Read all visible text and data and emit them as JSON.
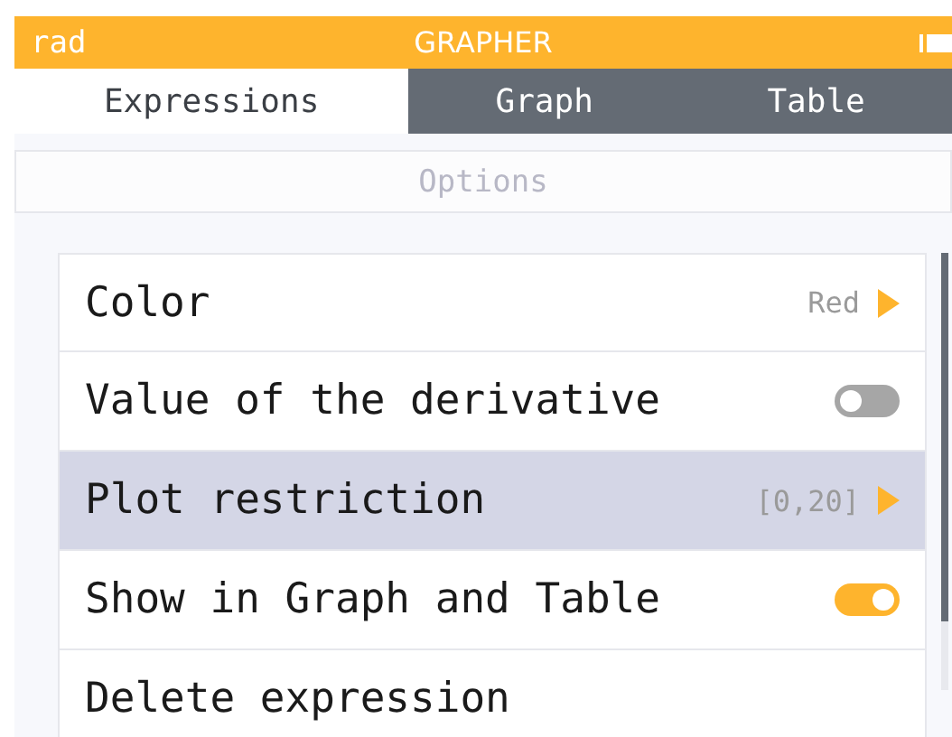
{
  "status_bar": {
    "angle_mode": "rad",
    "title": "GRAPHER"
  },
  "tabs": [
    {
      "label": "Expressions",
      "selected": true
    },
    {
      "label": "Graph",
      "selected": false
    },
    {
      "label": "Table",
      "selected": false
    }
  ],
  "header": {
    "title": "Options"
  },
  "options": [
    {
      "kind": "submenu",
      "label": "Color",
      "value": "Red",
      "selected": false
    },
    {
      "kind": "toggle",
      "label": "Value of the derivative",
      "on": false,
      "selected": false
    },
    {
      "kind": "submenu",
      "label": "Plot restriction",
      "value": "[0,20]",
      "selected": true
    },
    {
      "kind": "toggle",
      "label": "Show in Graph and Table",
      "on": true,
      "selected": false
    },
    {
      "kind": "action",
      "label": "Delete expression",
      "selected": false
    }
  ]
}
